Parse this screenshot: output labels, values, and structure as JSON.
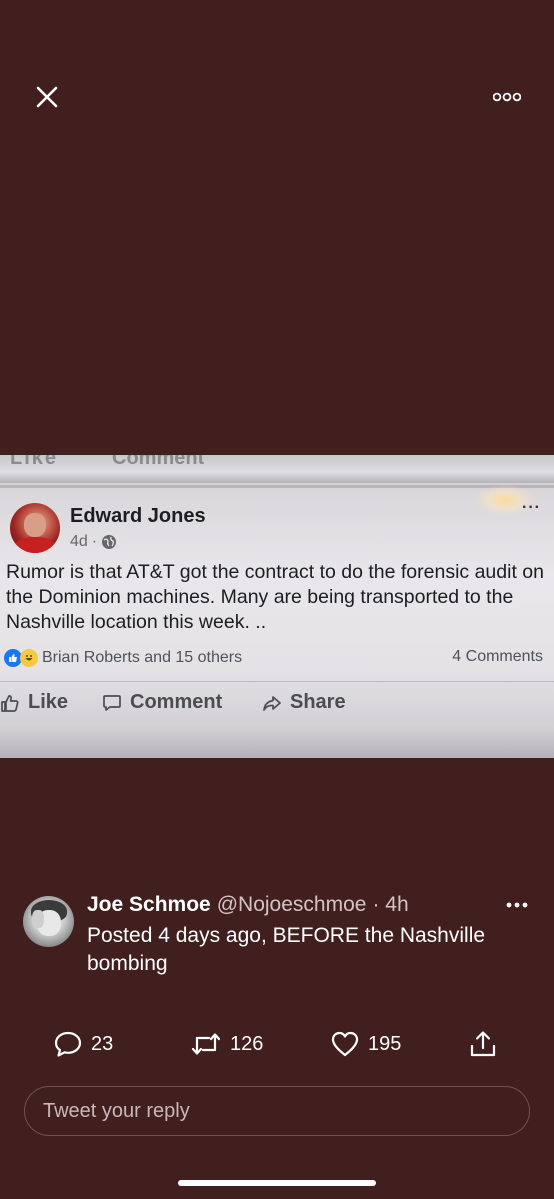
{
  "viewer": {
    "close_icon": "close-icon",
    "more_icon": "more-options-icon"
  },
  "photo": {
    "ghost_text_left": "Like",
    "ghost_text_right": "Comment",
    "fb_post": {
      "author": "Edward Jones",
      "time": "4d",
      "privacy_icon": "globe-icon",
      "text": "Rumor is that AT&T got the contract to do the forensic audit on the Dominion machines. Many are being transported to the Nashville location this week. ..",
      "reactions_text": "Brian Roberts and 15 others",
      "comments_count": "4 Comments",
      "actions": {
        "like": "Like",
        "comment": "Comment",
        "share": "Share"
      },
      "more_dots": "···"
    }
  },
  "tweet": {
    "name": "Joe Schmoe",
    "handle": "@Nojoeschmoe",
    "time": "· 4h",
    "text": "Posted 4 days ago, BEFORE the Nashville bombing",
    "replies": "23",
    "retweets": "126",
    "likes": "195"
  },
  "reply": {
    "placeholder": "Tweet your reply"
  },
  "colors": {
    "background": "#421f1f",
    "text": "#ffffff",
    "facebook_blue": "#1877f2"
  }
}
